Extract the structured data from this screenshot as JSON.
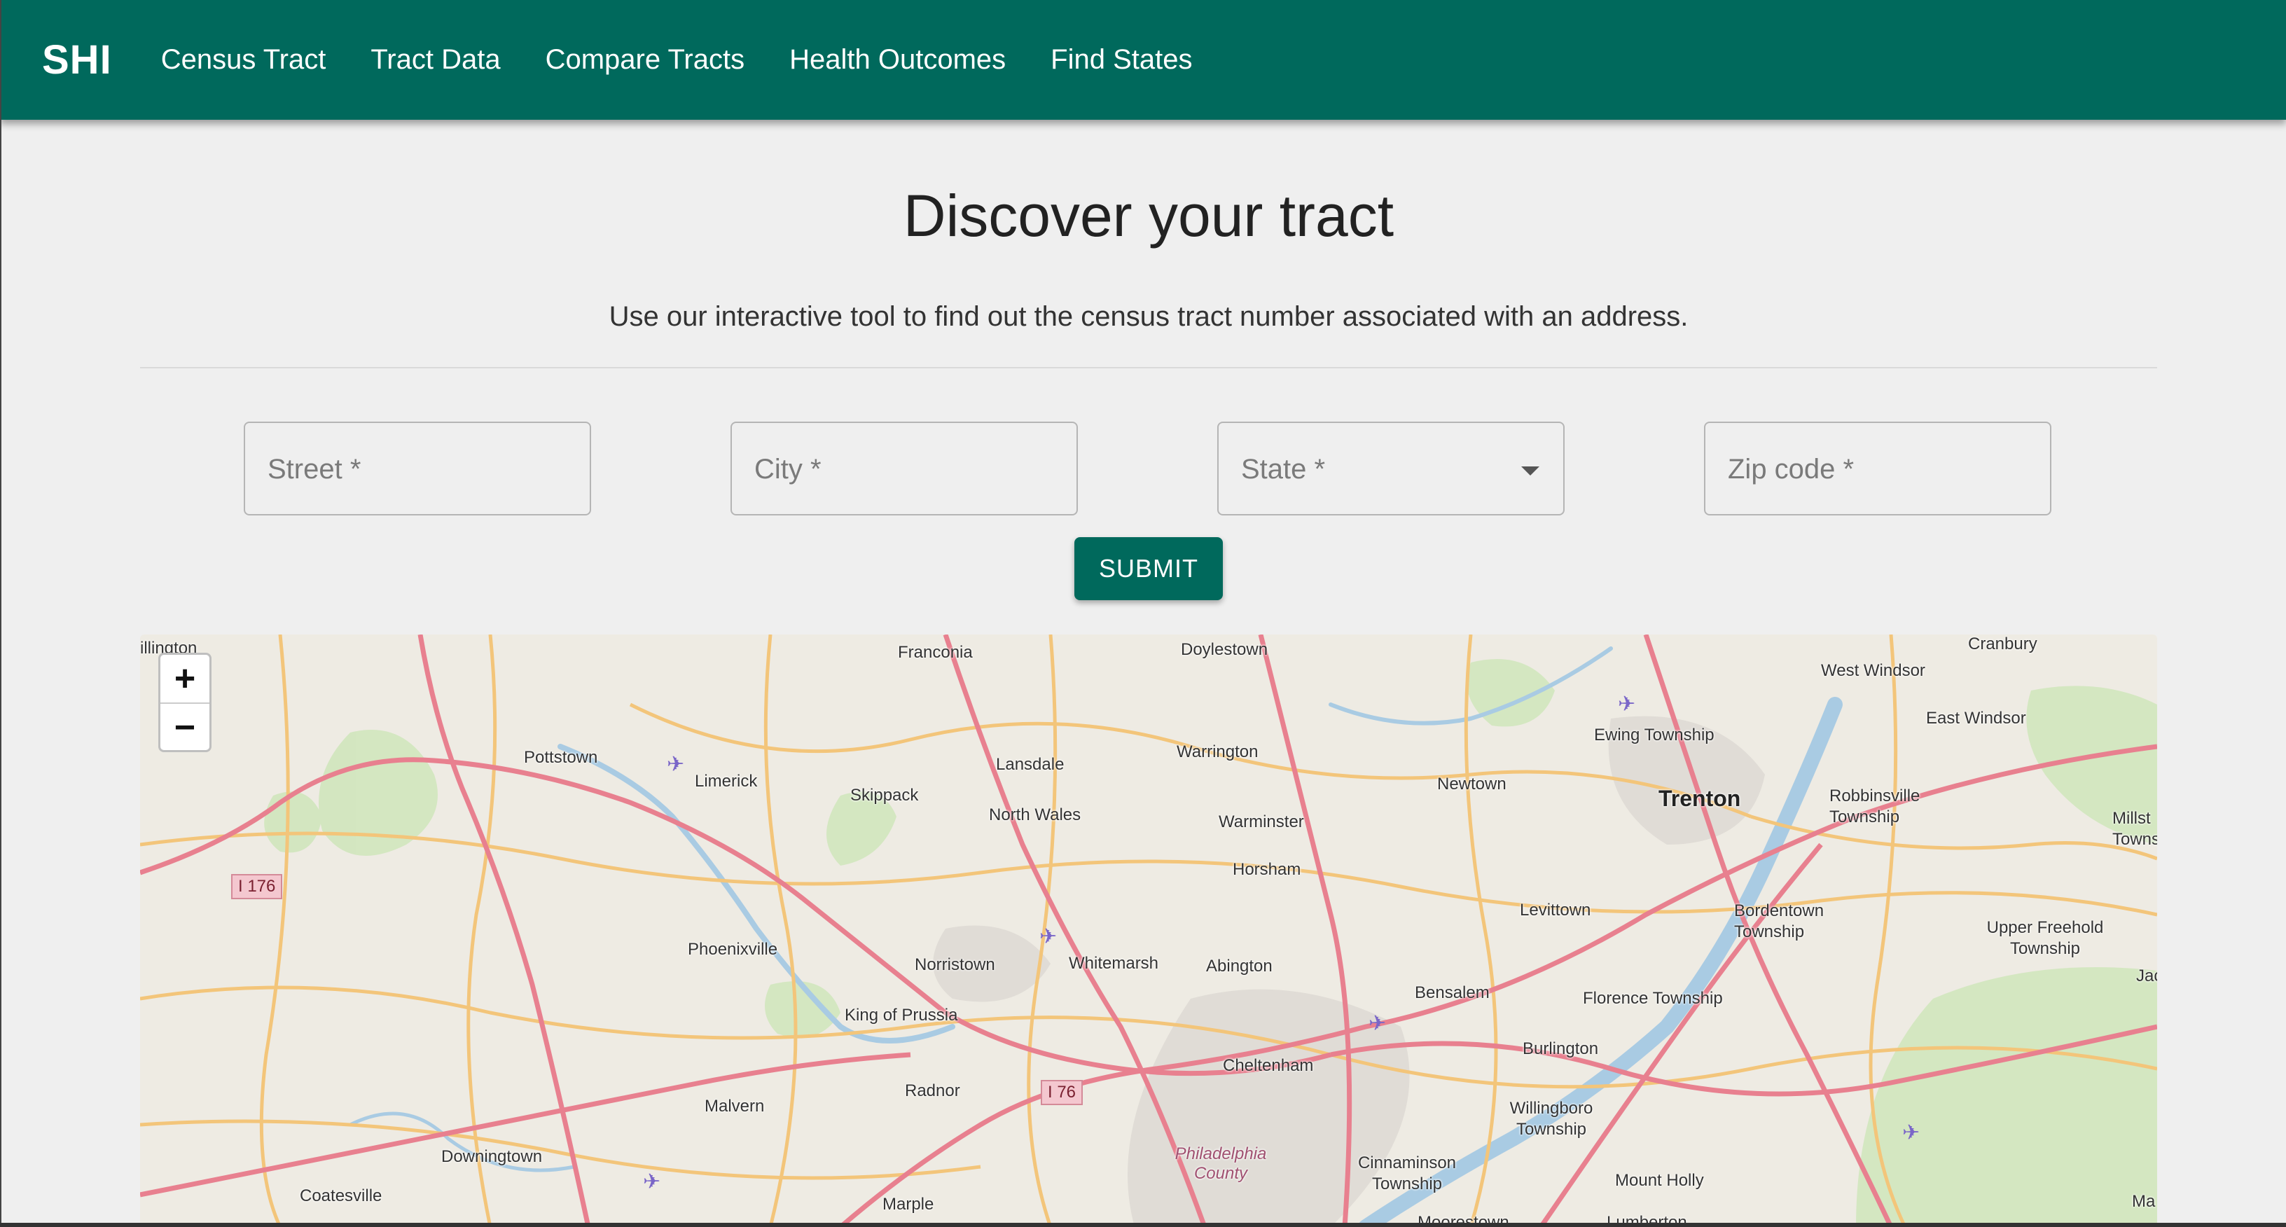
{
  "nav": {
    "brand": "SHI",
    "links": [
      "Census Tract",
      "Tract Data",
      "Compare Tracts",
      "Health Outcomes",
      "Find States"
    ]
  },
  "hero": {
    "title": "Discover your tract",
    "subtitle": "Use our interactive tool to find out the census tract number associated with an address."
  },
  "form": {
    "street_placeholder": "Street *",
    "city_placeholder": "City *",
    "state_placeholder": "State *",
    "zip_placeholder": "Zip code *",
    "submit_label": "SUBMIT"
  },
  "map": {
    "zoom_in": "+",
    "zoom_out": "−",
    "places": [
      "illington",
      "Franconia",
      "Doylestown",
      "Cranbury",
      "West Windsor",
      "East Windsor",
      "Pottstown",
      "Limerick",
      "Lansdale",
      "Warrington",
      "Ewing Township",
      "Skippack",
      "North Wales",
      "Newtown",
      "Trenton",
      "Robbinsville Township",
      "Millst Towns",
      "Warminster",
      "Horsham",
      "Levittown",
      "Bordentown Township",
      "Upper Freehold Township",
      "Phoenixville",
      "Norristown",
      "Whitemarsh",
      "Abington",
      "Jac",
      "King of Prussia",
      "Bensalem",
      "Florence Township",
      "Burlington",
      "Cheltenham",
      "Radnor",
      "Malvern",
      "Willingboro Township",
      "Philadelphia County",
      "Downingtown",
      "Cinnaminson Township",
      "Mount Holly",
      "Coatesville",
      "Marple",
      "Moorestown",
      "Lumberton",
      "Ma"
    ],
    "shields": [
      "I 176",
      "I 76"
    ],
    "colors": {
      "road_major": "#e8808f",
      "road_minor": "#f3c57a",
      "river": "#a9cbe3",
      "park": "#cde7b8"
    }
  }
}
